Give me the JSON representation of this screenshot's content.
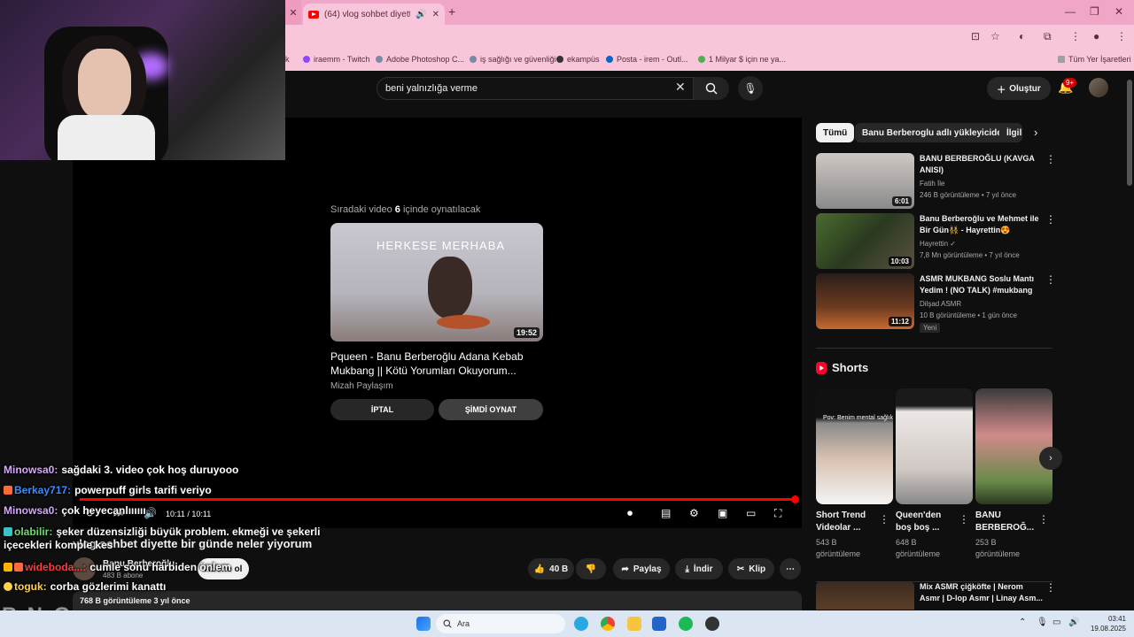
{
  "browser": {
    "tab_title": "(64) vlog sohbet diyette bir",
    "new_tab": "+",
    "bookmarks": [
      "k",
      "iraemm - Twitch",
      "Adobe Photoshop C...",
      "iş sağlığı ve güvenliği",
      "ekampüs",
      "Posta - irem - Outl...",
      "1 Milyar $ için ne ya...",
      "Tüm Yer İşaretleri"
    ]
  },
  "topbar": {
    "search_value": "beni yalnızlığa verme",
    "create_label": "Oluştur",
    "notif_badge": "9+"
  },
  "player": {
    "up_next_prefix": "Sıradaki video",
    "up_next_count": "6",
    "up_next_suffix": "içinde oynatılacak",
    "thumb_text": "HERKESE MERHABA",
    "next_duration": "19:52",
    "next_title": "Pqueen - Banu Berberoğlu Adana Kebab Mukbang || Kötü Yorumları Okuyorum...",
    "next_channel": "Mizah Paylaşım",
    "cancel_label": "İPTAL",
    "playnow_label": "ŞİMDİ OYNAT",
    "time": "10:11 / 10:11",
    "progress": 1.0
  },
  "video": {
    "title": "vlog sohbet diyette bir günde neler yiyorum",
    "channel": "Banu Berberoğlu",
    "subs": "483 B abone",
    "subscribe_label": "Abone ol",
    "likes": "40 B",
    "share_label": "Paylaş",
    "download_label": "İndir",
    "clip_label": "Klip",
    "meta": "768 B görüntüleme  3 yıl önce"
  },
  "sidebar": {
    "chips": [
      "Tümü",
      "Banu Berberoglu adlı yükleyiciden",
      "İlgili"
    ],
    "recs": [
      {
        "title": "BANU BERBEROĞLU (KAVGA ANISI)",
        "channel": "Fatih İle",
        "meta": "246 B görüntüleme • 7 yıl önce",
        "duration": "6:01"
      },
      {
        "title": "Banu Berberoğlu ve Mehmet ile Bir Gün👯 - Hayrettin😍",
        "channel": "Hayrettin ✓",
        "meta": "7,8 Mn görüntüleme • 7 yıl önce",
        "duration": "10:03"
      },
      {
        "title": "ASMR MUKBANG Soslu Mantı Yedim ! (NO TALK) #mukbang",
        "channel": "Dilşad ASMR",
        "meta": "10 B görüntüleme • 1 gün önce",
        "duration": "11:12",
        "badge": "Yeni"
      },
      {
        "title": "Mix ASMR çiğköfte | Nerom Asmr | D-lop Asmr | Linay Asm...",
        "channel": "",
        "meta": "",
        "duration": ""
      }
    ],
    "shorts_title": "Shorts",
    "shorts": [
      {
        "title": "Short Trend Videolar ...",
        "views": "543 B görüntüleme",
        "overlay": "Pov: Benim mental sağlık"
      },
      {
        "title": "Queen'den boş boş ...",
        "views": "648 B görüntüleme",
        "overlay": ""
      },
      {
        "title": "BANU BERBEROĞ...",
        "views": "253 B görüntüleme",
        "overlay": ""
      }
    ]
  },
  "chat": [
    {
      "user": "Minowsa0:",
      "text": "sağdaki 3. video çok hoş duruyooo",
      "color": "#d8a6ff"
    },
    {
      "user": "Berkay717:",
      "text": "powerpuff girls tarifi veriyo",
      "color": "#3a8bff"
    },
    {
      "user": "Minowsa0:",
      "text": "çok heyecanlıııııı",
      "color": "#d8a6ff"
    },
    {
      "user": "olabilir:",
      "text": "şeker düzensizliği büyük problem. ekmeği ve şekerli içecekleri komple kes",
      "color": "#6fdc6f"
    },
    {
      "user": "wideboda...:",
      "text": "cumle sonu harbiden önlem",
      "color": "#ff3b3b"
    },
    {
      "user": "toguk:",
      "text": "corba gözlerimi kanattı",
      "color": "#ffd34d"
    }
  ],
  "watermark": "ByNoGame",
  "taskbar": {
    "search_placeholder": "Ara",
    "time": "03:41",
    "date": "19.08.2025"
  }
}
